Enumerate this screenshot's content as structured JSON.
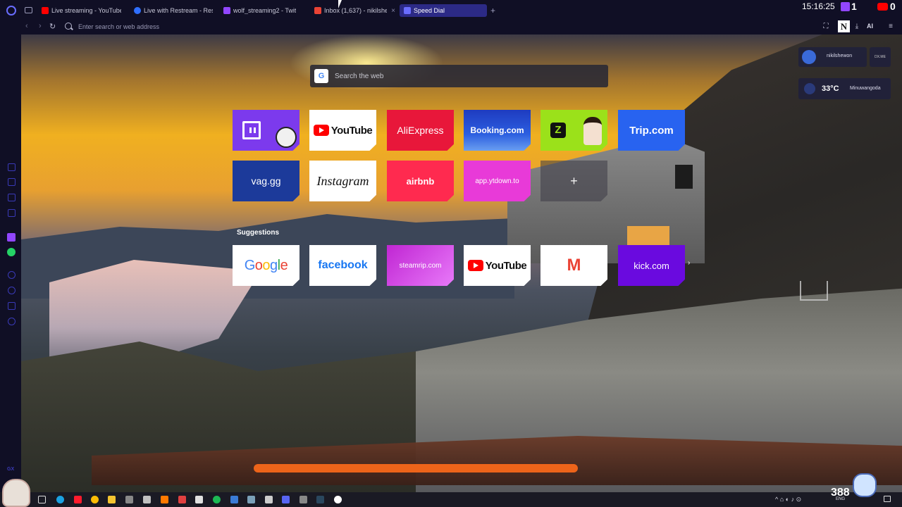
{
  "browser": {
    "tabs": [
      {
        "title": "Live streaming - YouTube",
        "favicon_color": "#ff0000"
      },
      {
        "title": "Live with Restream - Restr",
        "favicon_color": "#2f6fff"
      },
      {
        "title": "wolf_streaming2 - Twit",
        "favicon_color": "#9146ff"
      },
      {
        "title": "Inbox (1,637) - nikilshe",
        "favicon_color": "#ea4335"
      },
      {
        "title": "Speed Dial",
        "favicon_color": "#6a6dff"
      }
    ],
    "clock": "15:16:25",
    "twitch_count": "1",
    "youtube_count": "0",
    "address_placeholder": "Enter search or web address",
    "ai_label": "AI",
    "n_extension": "N"
  },
  "speed_dial": {
    "search_placeholder": "Search the web",
    "search_engine_badge": "G",
    "tiles": [
      {
        "id": "twitch",
        "label": ""
      },
      {
        "id": "youtube",
        "label": "YouTube"
      },
      {
        "id": "aliexpress",
        "label": "AliExpress"
      },
      {
        "id": "booking",
        "label": "Booking.com"
      },
      {
        "id": "zzz",
        "label": "Z"
      },
      {
        "id": "trip",
        "label": "Trip.com"
      },
      {
        "id": "vag",
        "label": "vag.gg"
      },
      {
        "id": "instagram",
        "label": "Instagram"
      },
      {
        "id": "airbnb",
        "label": "airbnb"
      },
      {
        "id": "ytdown",
        "label": "app.ytdown.to"
      },
      {
        "id": "add",
        "label": "+"
      }
    ],
    "suggestions_heading": "Suggestions",
    "suggestions": [
      {
        "id": "google",
        "label": "Google"
      },
      {
        "id": "facebook",
        "label": "facebook"
      },
      {
        "id": "steamrip",
        "label": "steamrip.com"
      },
      {
        "id": "youtube",
        "label": "YouTube"
      },
      {
        "id": "gmail",
        "label": "M"
      },
      {
        "id": "kick",
        "label": "kick.com"
      }
    ]
  },
  "widgets": {
    "profile_name": "nikilshewon",
    "dxme": "DX.ME",
    "temperature": "33°C",
    "city": "Minuwangoda"
  },
  "overlay": {
    "viewer_count": "388",
    "gx_label": "GX"
  },
  "taskbar": {
    "language": "ENG"
  }
}
